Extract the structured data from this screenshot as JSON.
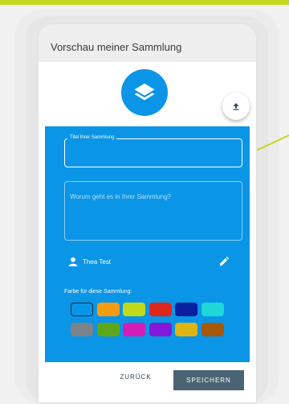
{
  "appbar": {
    "title": "Vorschau meiner Sammlung"
  },
  "logo": {
    "icon": "layers-icon",
    "color": "#0a95e6"
  },
  "upload": {
    "icon": "upload-icon"
  },
  "form": {
    "title_field": {
      "label": "Titel Ihrer Sammlung",
      "value": ""
    },
    "description_field": {
      "placeholder": "Worum geht es in Ihrer Sammlung?",
      "value": ""
    },
    "owner": {
      "name": "Thea Test",
      "icon": "person-icon",
      "edit_icon": "pencil-icon"
    },
    "color_label": "Farbe für diese Sammlung:",
    "colors": [
      "#0a95e6",
      "#f39c12",
      "#c2d91a",
      "#e0251b",
      "#0a1ea0",
      "#1ed7d7",
      "#7a828a",
      "#5ea818",
      "#d61bb7",
      "#8418d8",
      "#e0b50e",
      "#a8580a"
    ],
    "selected_color_index": 0
  },
  "actions": {
    "back_label": "ZURÜCK",
    "save_label": "SPEICHERN"
  },
  "theme": {
    "panel": "#0a95e6",
    "accent": "#c6d81e",
    "primary_button": "#4b6473"
  }
}
